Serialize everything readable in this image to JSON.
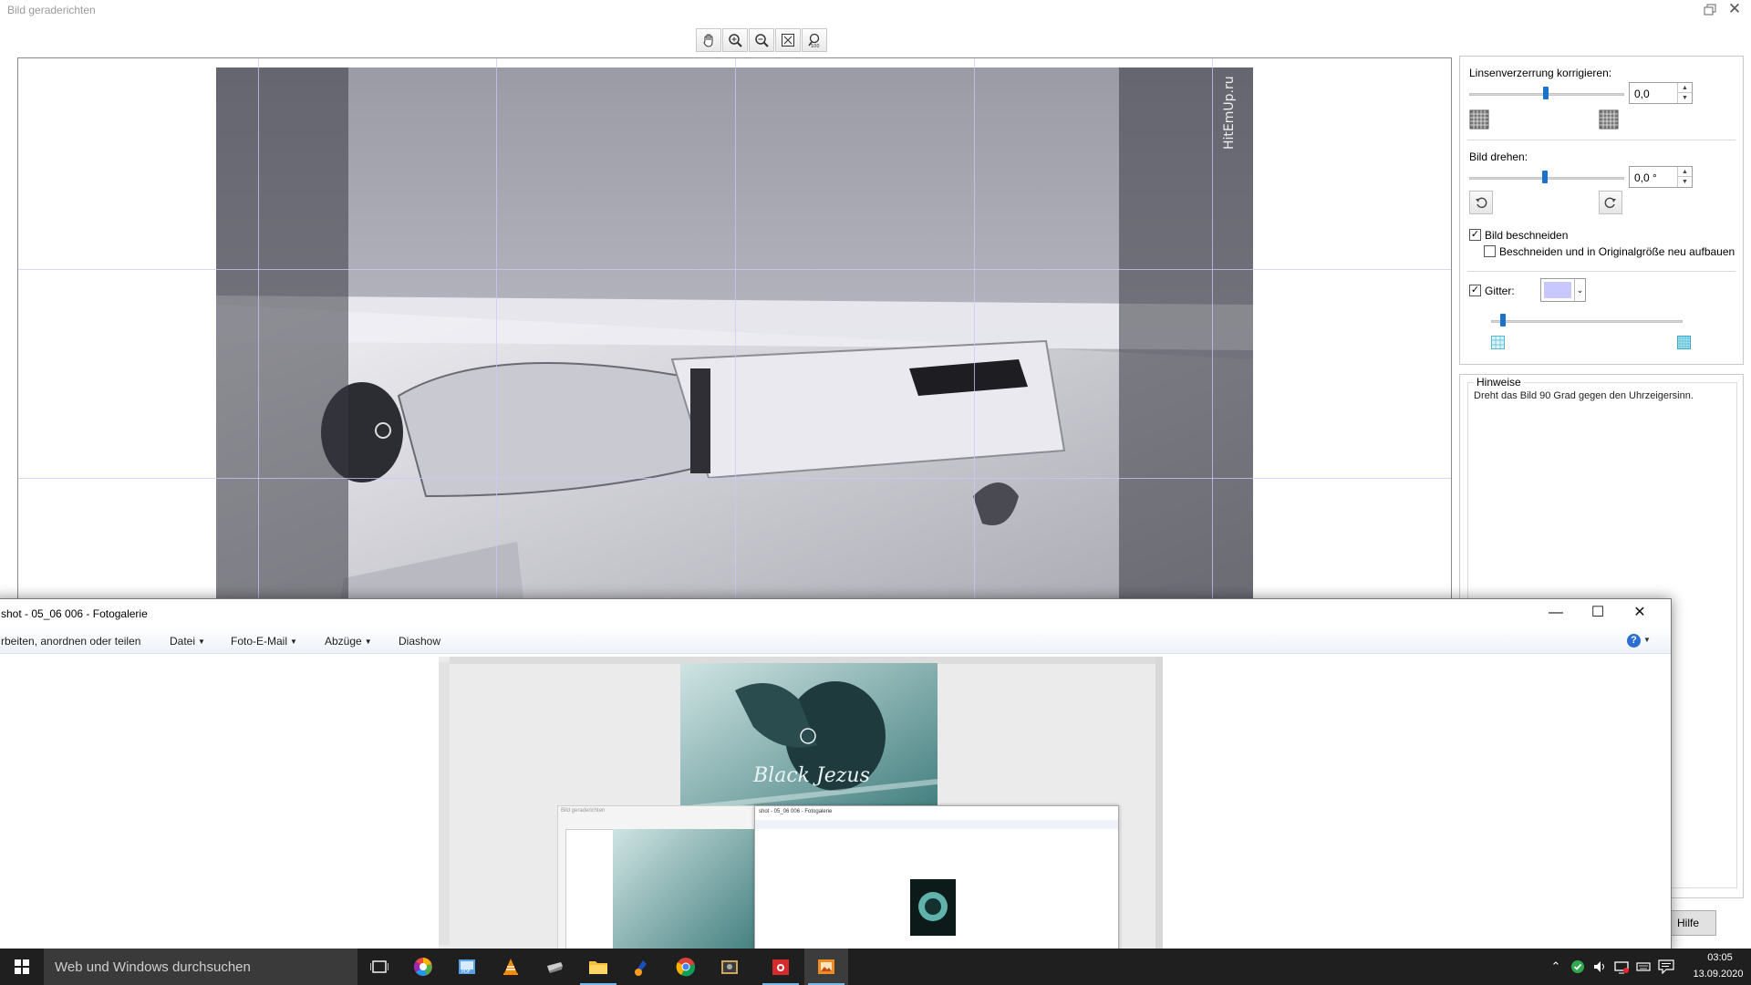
{
  "straighten_window": {
    "title": "Bild geraderichten",
    "toolbar_icons": [
      "hand-icon",
      "zoom-in-icon",
      "zoom-out-icon",
      "fit-to-window-icon",
      "actual-size-icon"
    ],
    "lens": {
      "label": "Linsenverzerrung korrigieren:",
      "value": "0,0",
      "slider_fraction": 0.5
    },
    "rotate": {
      "label": "Bild drehen:",
      "value": "0,0 °",
      "slider_fraction": 0.5
    },
    "crop": {
      "label": "Bild beschneiden",
      "checked": true,
      "rebuild_label": "Beschneiden und in Originalgröße neu aufbauen",
      "rebuild_checked": false
    },
    "grid": {
      "label": "Gitter:",
      "checked": true,
      "color": "#c8c8ff",
      "slider_fraction": 0.05
    },
    "hints": {
      "title": "Hinweise",
      "text": "Dreht das Bild 90 Grad gegen den Uhrzeigersinn."
    },
    "help_button": "Hilfe",
    "watermark": "HitEmUp.ru"
  },
  "gallery_window": {
    "title": "shot - 05_06 006 - Fotogalerie",
    "menu": {
      "edit": "rbeiten, anordnen oder teilen",
      "file": "Datei",
      "email": "Foto-E-Mail",
      "prints": "Abzüge",
      "slideshow": "Diashow"
    },
    "preview_text": "Black Jezus"
  },
  "taskbar": {
    "search_placeholder": "Web und Windows durchsuchen",
    "time": "03:05",
    "date": "13.09.2020"
  }
}
